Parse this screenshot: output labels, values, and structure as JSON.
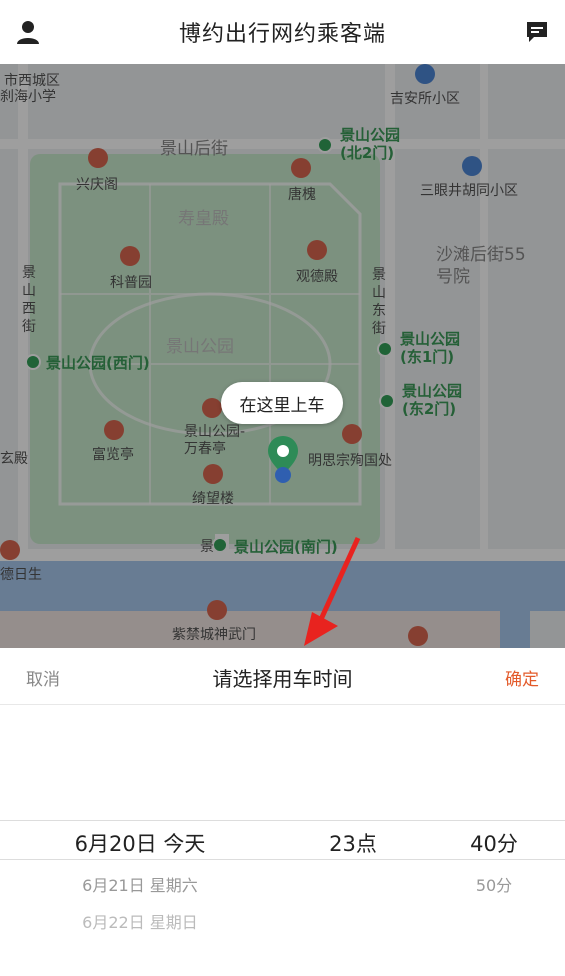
{
  "header": {
    "title": "博约出行网约乘客端",
    "left_icon": "user-icon",
    "right_icon": "message-icon"
  },
  "map": {
    "pickup_bubble": "在这里上车",
    "labels": {
      "xicheng_district": "市西城区",
      "school": "刹海小学",
      "jian_anli": "吉安所小区",
      "jingshan_houjie": "景山后街",
      "north_gate": "景山公园(北2门)",
      "sanyanjing": "三眼井胡同小区",
      "xingqingge": "兴庆阁",
      "tanghuai": "唐槐",
      "shouhuangdian": "寿皇殿",
      "kepuyuan": "科普园",
      "guandedian": "观德殿",
      "shatan": "沙滩后街55号院",
      "jingshan_xijie": "景山西街",
      "jingshan_dongjie": "景山东街",
      "west_gate": "景山公园(西门)",
      "jingshan_park": "景山公园",
      "east_gate1": "景山公园(东1门)",
      "east_gate2": "景山公园(东2门)",
      "fulanting": "富览亭",
      "wanchunting": "景山公园-万春亭",
      "mingsi": "明思宗殉国处",
      "qiwanglou": "绮望楼",
      "south_gate": "景山公园(南门)",
      "shenwumen": "紫禁城神武门",
      "xuandian": "玄殿",
      "derisheng": "德日生",
      "jing_prefix": "景"
    }
  },
  "sheet": {
    "cancel_label": "取消",
    "title": "请选择用车时间",
    "confirm_label": "确定",
    "dates": [
      "6月20日 今天",
      "6月21日 星期六",
      "6月22日 星期日"
    ],
    "hours": [
      "23点"
    ],
    "minutes": [
      "40分",
      "50分"
    ]
  },
  "colors": {
    "accent": "#e35a2a",
    "park_green": "#3c9b5a",
    "poi_red": "#d9664f"
  }
}
